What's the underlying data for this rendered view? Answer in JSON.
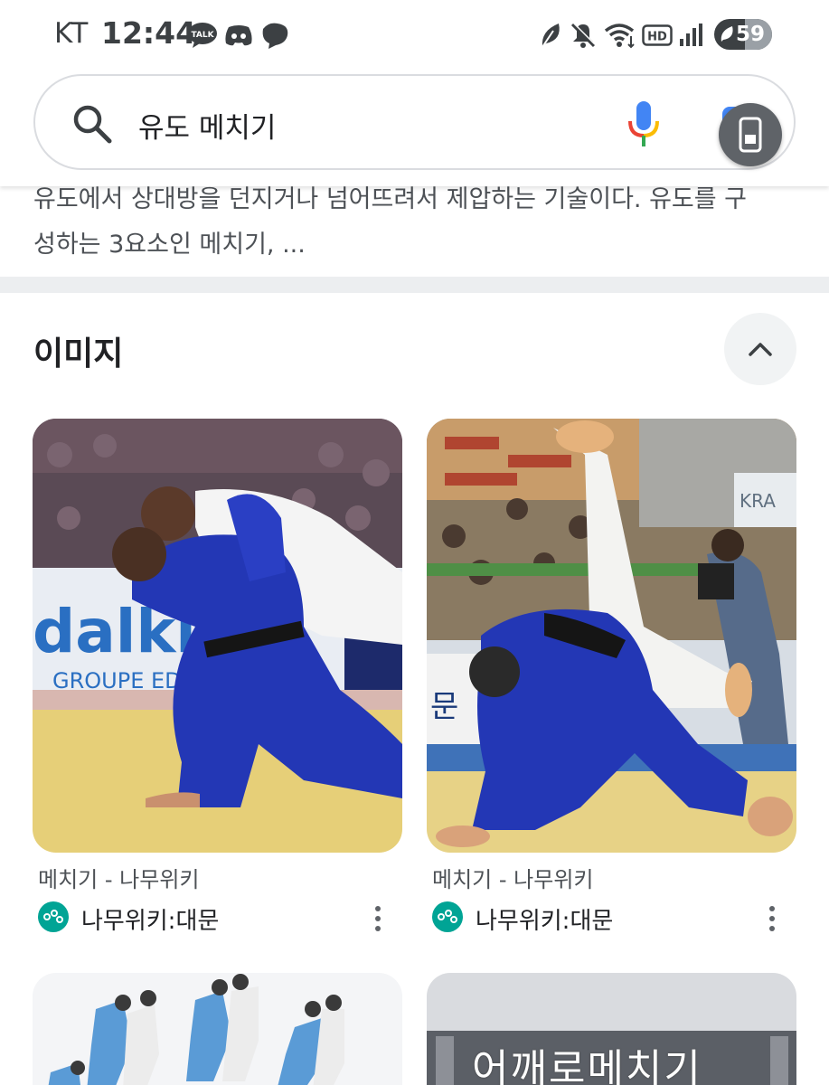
{
  "status_bar": {
    "carrier": "KT",
    "time": "12:44",
    "notification_icons": [
      "kakaotalk-icon",
      "discord-icon",
      "line-chat-icon"
    ],
    "system_icons": [
      "leaf-icon",
      "mute-icon",
      "wifi-icon",
      "hd-icon",
      "signal-icon"
    ],
    "battery": "59"
  },
  "search": {
    "query": "유도 메치기"
  },
  "snippet": {
    "line1": "유도에서 상대방을 던지거나 넘어뜨려서 제압하는 기술이다. 유도를 구",
    "line2": "성하는 3요소인 메치기, ..."
  },
  "images_section": {
    "title": "이미지",
    "cards": [
      {
        "title": "메치기 - 나무위키",
        "source": "나무위키:대문"
      },
      {
        "title": "메치기 - 나무위키",
        "source": "나무위키:대문"
      }
    ],
    "partial_cards": [
      {
        "image_text": ""
      },
      {
        "image_text": "어깨로메치기"
      }
    ]
  },
  "colors": {
    "judogi_blue": "#2337b5",
    "favicon": "#00a495",
    "mat_yellow": "#e8d27a"
  }
}
